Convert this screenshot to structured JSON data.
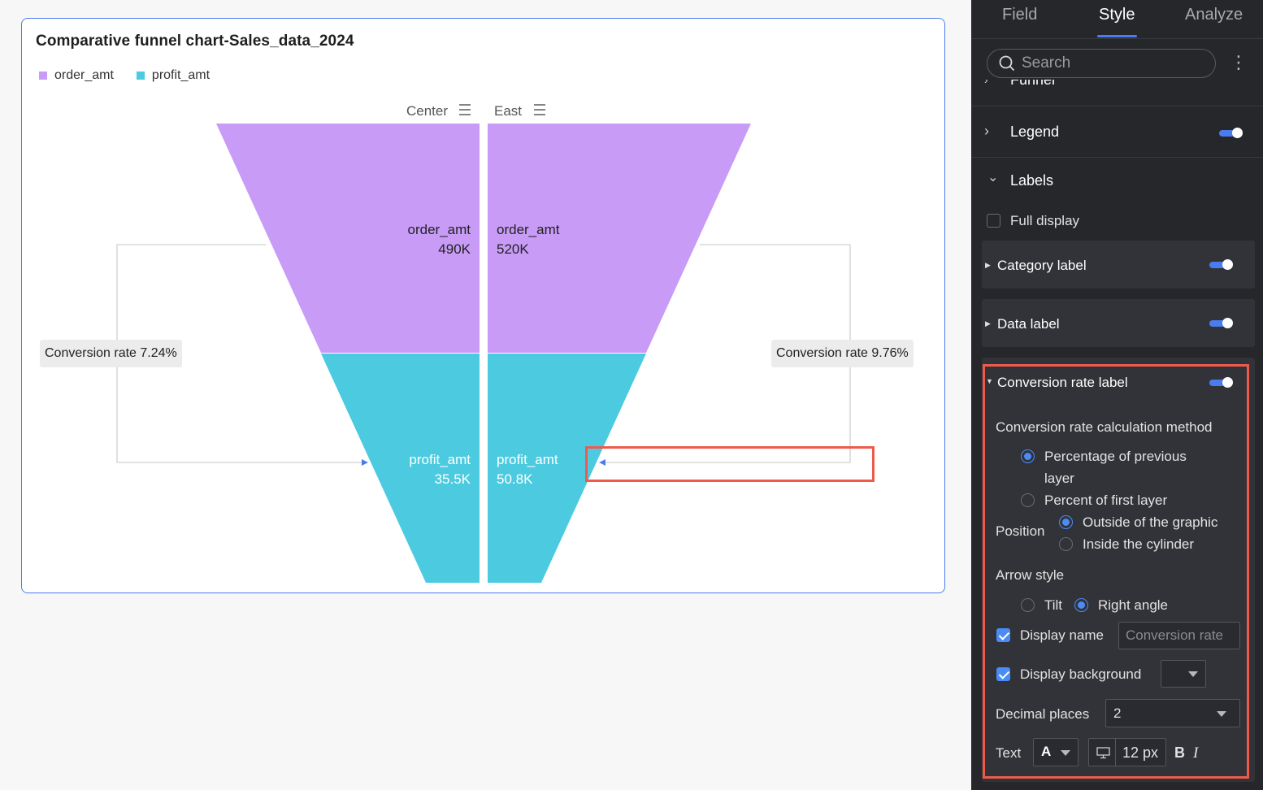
{
  "chart": {
    "title": "Comparative funnel chart-Sales_data_2024",
    "legend": [
      {
        "label": "order_amt",
        "color": "#c89bf7"
      },
      {
        "label": "profit_amt",
        "color": "#4ccbe0"
      }
    ],
    "conversion_left": "Conversion rate 7.24%",
    "conversion_right": "Conversion rate 9.76%"
  },
  "chart_data": {
    "type": "funnel",
    "title": "Comparative funnel chart-Sales_data_2024",
    "groups": [
      "Center",
      "East"
    ],
    "stages": [
      "order_amt",
      "profit_amt"
    ],
    "series": [
      {
        "name": "Center",
        "values": [
          490000,
          35500
        ],
        "labels": [
          "490K",
          "35.5K"
        ],
        "conversion_rate": 7.24
      },
      {
        "name": "East",
        "values": [
          520000,
          50800
        ],
        "labels": [
          "520K",
          "50.8K"
        ],
        "conversion_rate": 9.76
      }
    ],
    "colors": {
      "order_amt": "#c89bf7",
      "profit_amt": "#4ccbe0"
    },
    "legend_position": "top-left"
  },
  "panel": {
    "tabs": [
      "Field",
      "Style",
      "Analyze"
    ],
    "active_tab": "Style",
    "search_placeholder": "Search",
    "partial_section": "Funnel",
    "legend_section": "Legend",
    "labels_section": "Labels",
    "full_display": "Full display",
    "category_label": "Category label",
    "data_label": "Data label",
    "conversion_rate_label": "Conversion rate label",
    "calc_method_title": "Conversion rate calculation method",
    "calc_option_1_line1": "Percentage of previous",
    "calc_option_1_line2": "layer",
    "calc_option_2": "Percent of first layer",
    "position_title": "Position",
    "position_option_1": "Outside of the graphic",
    "position_option_2": "Inside the cylinder",
    "arrow_style_title": "Arrow style",
    "arrow_option_1": "Tilt",
    "arrow_option_2": "Right angle",
    "display_name": "Display name",
    "display_name_placeholder": "Conversion rate",
    "display_background": "Display background",
    "decimal_places": "Decimal places",
    "decimal_value": "2",
    "text_label": "Text",
    "font_glyph": "A",
    "font_size": "12",
    "font_unit": "px",
    "bold_glyph": "B",
    "italic_glyph": "I"
  }
}
